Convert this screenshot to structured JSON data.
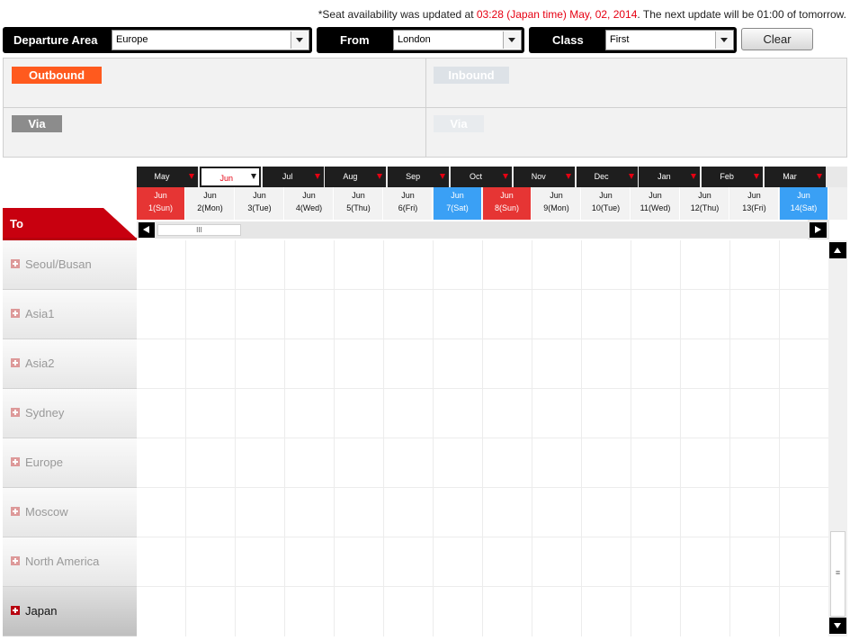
{
  "notice": {
    "prefix": "*Seat availability was updated at ",
    "highlight": "03:28 (Japan time) May, 02, 2014",
    "suffix": ". The next update will be 01:00 of tomorrow."
  },
  "selectors": {
    "departure_area": {
      "label": "Departure Area",
      "value": "Europe"
    },
    "from": {
      "label": "From",
      "value": "London"
    },
    "class": {
      "label": "Class",
      "value": "First"
    }
  },
  "clear_label": "Clear",
  "route": {
    "outbound": "Outbound",
    "inbound": "Inbound",
    "via": "Via",
    "via_return": "Via"
  },
  "months": [
    {
      "label": "May",
      "selected": false
    },
    {
      "label": "Jun",
      "selected": true
    },
    {
      "label": "Jul",
      "selected": false
    },
    {
      "label": "Aug",
      "selected": false
    },
    {
      "label": "Sep",
      "selected": false
    },
    {
      "label": "Oct",
      "selected": false
    },
    {
      "label": "Nov",
      "selected": false
    },
    {
      "label": "Dec",
      "selected": false
    },
    {
      "label": "Jan",
      "selected": false
    },
    {
      "label": "Feb",
      "selected": false
    },
    {
      "label": "Mar",
      "selected": false
    }
  ],
  "days": [
    {
      "month": "Jun",
      "day": "1(Sun)",
      "style": "red"
    },
    {
      "month": "Jun",
      "day": "2(Mon)",
      "style": ""
    },
    {
      "month": "Jun",
      "day": "3(Tue)",
      "style": ""
    },
    {
      "month": "Jun",
      "day": "4(Wed)",
      "style": ""
    },
    {
      "month": "Jun",
      "day": "5(Thu)",
      "style": ""
    },
    {
      "month": "Jun",
      "day": "6(Fri)",
      "style": ""
    },
    {
      "month": "Jun",
      "day": "7(Sat)",
      "style": "blue"
    },
    {
      "month": "Jun",
      "day": "8(Sun)",
      "style": "red"
    },
    {
      "month": "Jun",
      "day": "9(Mon)",
      "style": ""
    },
    {
      "month": "Jun",
      "day": "10(Tue)",
      "style": ""
    },
    {
      "month": "Jun",
      "day": "11(Wed)",
      "style": ""
    },
    {
      "month": "Jun",
      "day": "12(Thu)",
      "style": ""
    },
    {
      "month": "Jun",
      "day": "13(Fri)",
      "style": ""
    },
    {
      "month": "Jun",
      "day": "14(Sat)",
      "style": "blue"
    }
  ],
  "to_label": "To",
  "destinations": [
    {
      "label": "Seoul/Busan",
      "active": false
    },
    {
      "label": "Asia1",
      "active": false
    },
    {
      "label": "Asia2",
      "active": false
    },
    {
      "label": "Sydney",
      "active": false
    },
    {
      "label": "Europe",
      "active": false
    },
    {
      "label": "Moscow",
      "active": false
    },
    {
      "label": "North America",
      "active": false
    },
    {
      "label": "Japan",
      "active": true
    }
  ],
  "scroll_grip": "III",
  "vscroll_grip": "≡",
  "colors": {
    "accent_red": "#e60012",
    "outbound": "#ff5a1e",
    "sunday": "#e63534",
    "saturday": "#3aa0f5"
  }
}
